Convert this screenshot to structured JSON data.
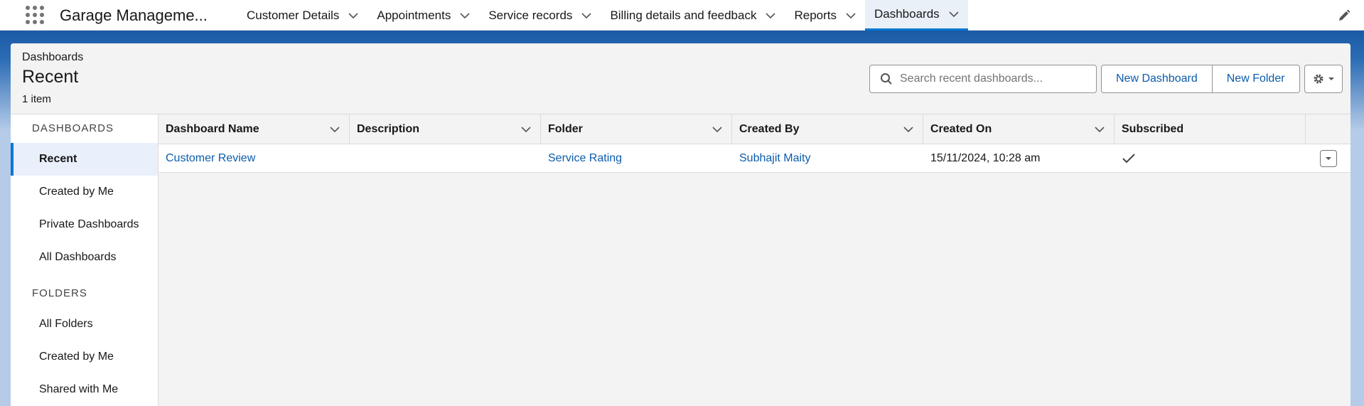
{
  "app": {
    "name": "Garage Manageme..."
  },
  "nav": {
    "items": [
      {
        "label": "Customer Details"
      },
      {
        "label": "Appointments"
      },
      {
        "label": "Service records"
      },
      {
        "label": "Billing details and feedback"
      },
      {
        "label": "Reports"
      },
      {
        "label": "Dashboards",
        "active": true
      }
    ]
  },
  "header": {
    "breadcrumb": "Dashboards",
    "title": "Recent",
    "count": "1 item",
    "search_placeholder": "Search recent dashboards...",
    "new_dashboard": "New Dashboard",
    "new_folder": "New Folder"
  },
  "sidebar": {
    "dashboards_heading": "DASHBOARDS",
    "dashboards": [
      "Recent",
      "Created by Me",
      "Private Dashboards",
      "All Dashboards"
    ],
    "folders_heading": "FOLDERS",
    "folders": [
      "All Folders",
      "Created by Me",
      "Shared with Me"
    ]
  },
  "table": {
    "columns": [
      "Dashboard Name",
      "Description",
      "Folder",
      "Created By",
      "Created On",
      "Subscribed"
    ],
    "rows": [
      {
        "name": "Customer Review",
        "description": "",
        "folder": "Service Rating",
        "created_by": "Subhajit Maity",
        "created_on": "15/11/2024, 10:28 am",
        "subscribed": true
      }
    ]
  },
  "colors": {
    "accent": "#0176d3",
    "link": "#0b5cab",
    "brand_band": "#1b5aa5"
  }
}
